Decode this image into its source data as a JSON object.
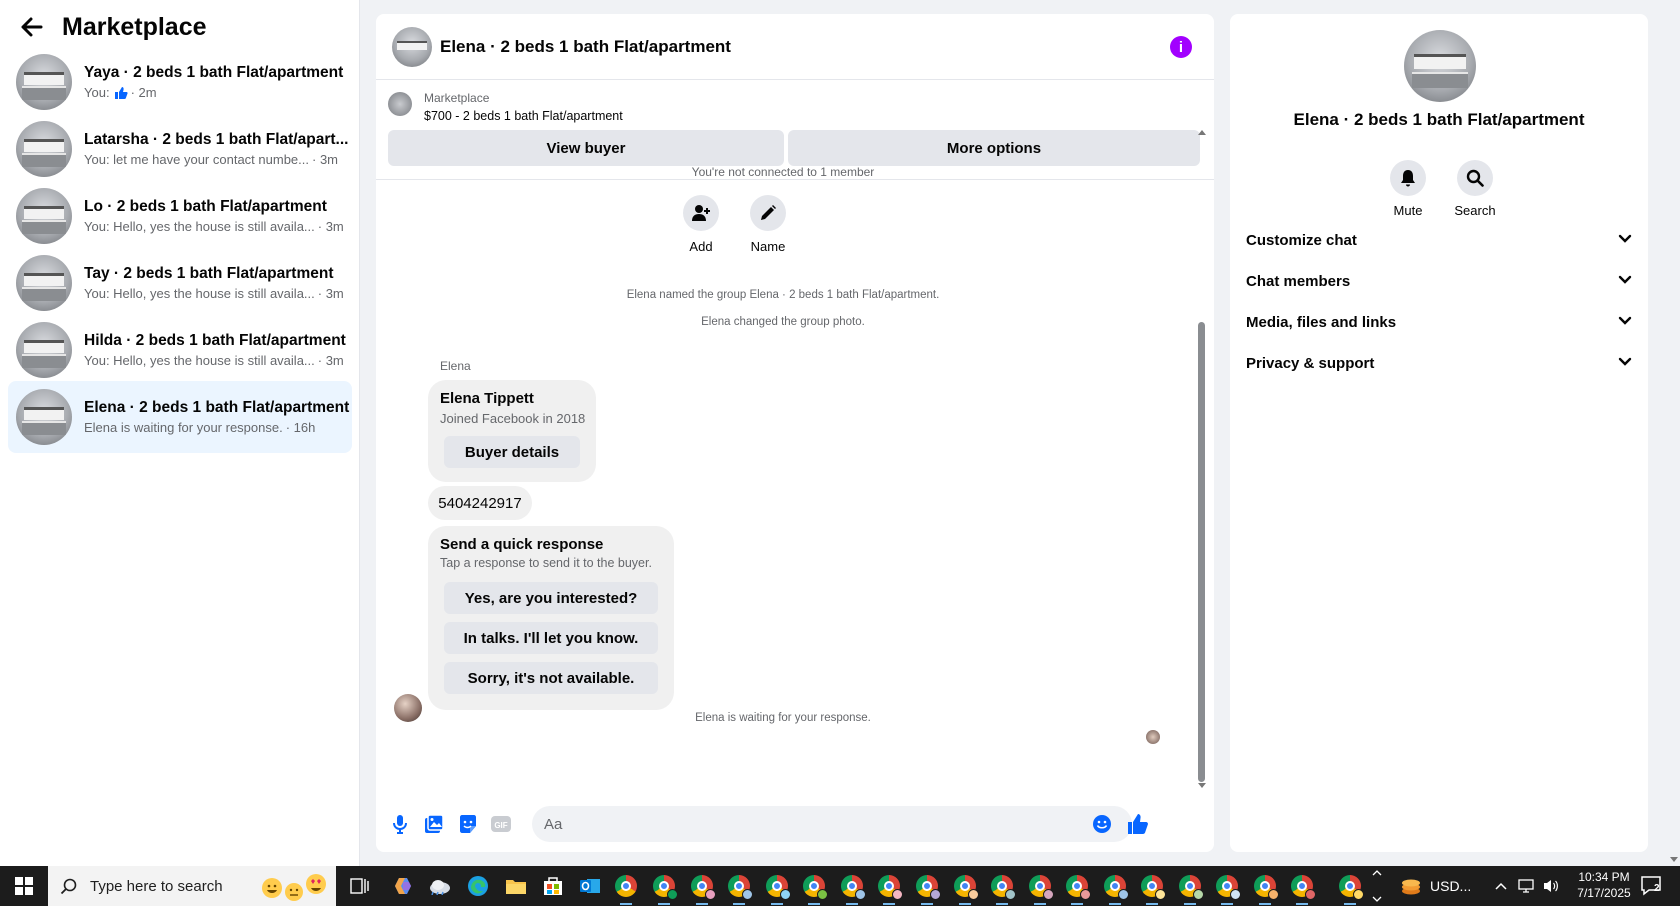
{
  "sidebar": {
    "title": "Marketplace",
    "conversations": [
      {
        "name": "Yaya · 2 beds 1 bath Flat/apartment",
        "preview": "You:",
        "time": "· 2m",
        "has_thumb_icon": true
      },
      {
        "name": "Latarsha · 2 beds 1 bath Flat/apart...",
        "preview": "You: let me have your contact numbe...",
        "time": "· 3m"
      },
      {
        "name": "Lo · 2 beds 1 bath Flat/apartment",
        "preview": "You: Hello, yes the house is still availa...",
        "time": "· 3m"
      },
      {
        "name": "Tay · 2 beds 1 bath Flat/apartment",
        "preview": "You: Hello, yes the house is still availa...",
        "time": "· 3m"
      },
      {
        "name": "Hilda · 2 beds 1 bath Flat/apartment",
        "preview": "You: Hello, yes the house is still availa...",
        "time": "· 3m"
      },
      {
        "name": "Elena · 2 beds 1 bath Flat/apartment",
        "preview": "Elena is waiting for your response.",
        "time": "· 16h",
        "active": true
      }
    ]
  },
  "chat": {
    "title": "Elena · 2 beds 1 bath Flat/apartment",
    "listing": {
      "label": "Marketplace",
      "price_title": "$700 - 2 beds 1 bath Flat/apartment"
    },
    "view_buyer": "View buyer",
    "more_options": "More options",
    "not_connected": "You're not connected to 1 member",
    "add_label": "Add",
    "name_label": "Name",
    "event_named": "Elena named the group Elena · 2 beds 1 bath Flat/apartment.",
    "event_photo": "Elena changed the group photo.",
    "sender": "Elena",
    "profile_card": {
      "name": "Elena Tippett",
      "joined": "Joined Facebook in 2018",
      "button": "Buyer details"
    },
    "phone_message": "5404242917",
    "quick_response": {
      "heading": "Send a quick response",
      "sub": "Tap a response to send it to the buyer.",
      "options": [
        "Yes, are you interested?",
        "In talks. I'll let you know.",
        "Sorry, it's not available."
      ]
    },
    "waiting_note": "Elena is waiting for your response.",
    "composer_placeholder": "Aa"
  },
  "right_panel": {
    "title": "Elena · 2 beds 1 bath Flat/apartment",
    "mute_label": "Mute",
    "search_label": "Search",
    "sections": [
      "Customize chat",
      "Chat members",
      "Media, files and links",
      "Privacy & support"
    ]
  },
  "taskbar": {
    "search_placeholder": "Type here to search",
    "tray_app_label": "USD...",
    "time": "10:34 PM",
    "date": "7/17/2025",
    "notification_count": "2"
  },
  "colors": {
    "accent_blue": "#0866ff",
    "info_purple": "#a200ff",
    "active_conv_bg": "#ebf5ff",
    "bubble_bg": "#f0f0f0",
    "taskbar_bg": "#1c1c1c"
  }
}
